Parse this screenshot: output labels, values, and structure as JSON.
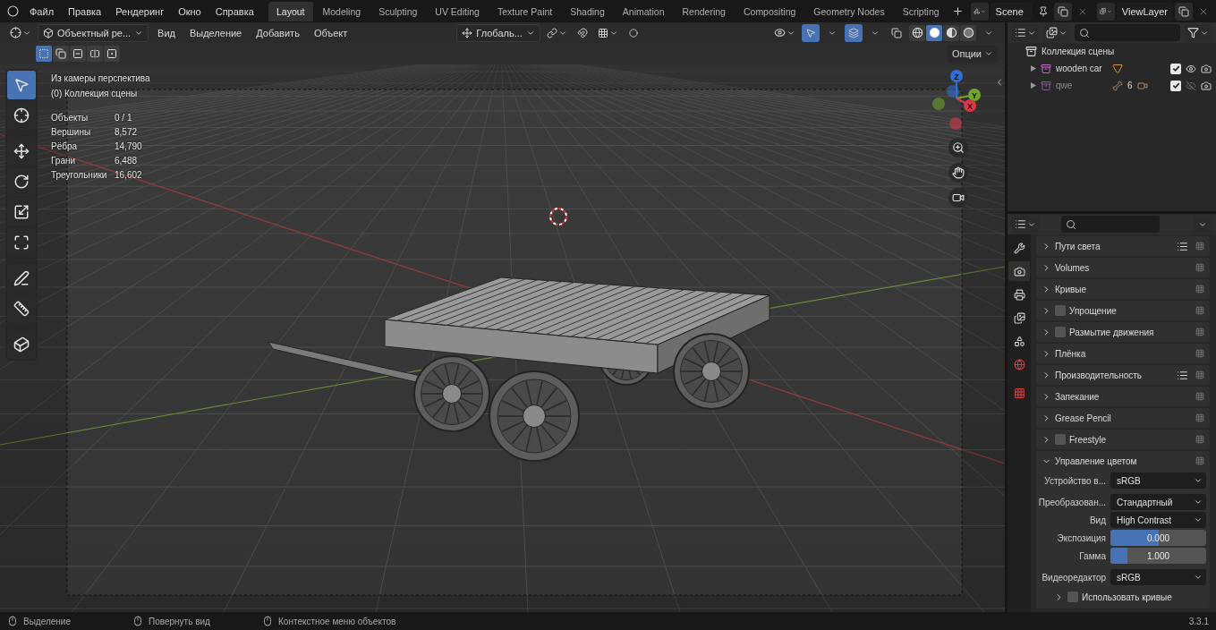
{
  "menu": [
    "Файл",
    "Правка",
    "Рендеринг",
    "Окно",
    "Справка"
  ],
  "workspaces": [
    {
      "label": "Layout",
      "selected": true
    },
    {
      "label": "Modeling",
      "selected": false
    },
    {
      "label": "Sculpting",
      "selected": false
    },
    {
      "label": "UV Editing",
      "selected": false
    },
    {
      "label": "Texture Paint",
      "selected": false
    },
    {
      "label": "Shading",
      "selected": false
    },
    {
      "label": "Animation",
      "selected": false
    },
    {
      "label": "Rendering",
      "selected": false
    },
    {
      "label": "Compositing",
      "selected": false
    },
    {
      "label": "Geometry Nodes",
      "selected": false
    },
    {
      "label": "Scripting",
      "selected": false
    }
  ],
  "scene": {
    "name": "Scene"
  },
  "view_layer": {
    "name": "ViewLayer"
  },
  "viewport_header": {
    "mode": "Объектный ре...",
    "menus": [
      "Вид",
      "Выделение",
      "Добавить",
      "Объект"
    ],
    "orientation": "Глобаль...",
    "shading": [
      {
        "kind": "wireframe",
        "selected": false
      },
      {
        "kind": "solid",
        "selected": true
      },
      {
        "kind": "material",
        "selected": false
      },
      {
        "kind": "rendered",
        "selected": false
      }
    ]
  },
  "select_modes": [
    {
      "kind": "new",
      "selected": true
    },
    {
      "kind": "extend",
      "selected": false
    },
    {
      "kind": "subtract",
      "selected": false
    },
    {
      "kind": "invert",
      "selected": false
    },
    {
      "kind": "intersect",
      "selected": false
    }
  ],
  "options_button": "Опции",
  "tools": [
    {
      "kind": "select",
      "selected": true
    },
    {
      "kind": "cursor",
      "selected": false
    },
    {
      "kind": "move",
      "selected": false
    },
    {
      "kind": "rotate",
      "selected": false
    },
    {
      "kind": "scale",
      "selected": false
    },
    {
      "kind": "transform",
      "selected": false
    },
    {
      "kind": "annotate",
      "selected": false
    },
    {
      "kind": "measure",
      "selected": false
    },
    {
      "kind": "add_cube",
      "selected": false
    }
  ],
  "overlay": {
    "view_name": "Из камеры перспектива",
    "collection": "(0) Коллекция сцены",
    "stats": [
      {
        "label": "Объекты",
        "value": "0 / 1"
      },
      {
        "label": "Вершины",
        "value": "8,572"
      },
      {
        "label": "Рёбра",
        "value": "14,790"
      },
      {
        "label": "Грани",
        "value": "6,488"
      },
      {
        "label": "Треугольники",
        "value": "16,602"
      }
    ]
  },
  "navigation_gizmo": {
    "axes": [
      {
        "label": "Z",
        "color": "#2f6fd6"
      },
      {
        "label": "Y",
        "color": "#6fa82b"
      },
      {
        "label": "X",
        "color": "#e0364a"
      }
    ]
  },
  "outliner": {
    "root": "Коллекция сцены",
    "items": [
      {
        "name": "wooden car",
        "kind": "object",
        "enabled": true,
        "visible": true
      },
      {
        "name": "qwe",
        "kind": "rig",
        "badge": "6",
        "enabled": true,
        "visible": false
      }
    ]
  },
  "properties": {
    "tabs": [
      {
        "kind": "tool",
        "selected": false
      },
      {
        "kind": "render",
        "selected": true
      },
      {
        "kind": "output",
        "selected": false
      },
      {
        "kind": "view_layer",
        "selected": false
      },
      {
        "kind": "scene",
        "selected": false
      },
      {
        "kind": "world",
        "selected": false
      },
      {
        "kind": "texture",
        "selected": false
      }
    ],
    "panels": [
      {
        "label": "Пути света",
        "kind": "plain",
        "presets": true
      },
      {
        "label": "Volumes",
        "kind": "plain",
        "presets": false
      },
      {
        "label": "Кривые",
        "kind": "plain",
        "presets": false
      },
      {
        "label": "Упрощение",
        "kind": "toggle",
        "checked": false,
        "presets": false
      },
      {
        "label": "Размытие движения",
        "kind": "toggle",
        "checked": false,
        "presets": false
      },
      {
        "label": "Плёнка",
        "kind": "plain",
        "presets": false
      },
      {
        "label": "Производительность",
        "kind": "plain",
        "presets": true
      },
      {
        "label": "Запекание",
        "kind": "plain",
        "presets": false
      },
      {
        "label": "Grease Pencil",
        "kind": "plain",
        "presets": false
      },
      {
        "label": "Freestyle",
        "kind": "toggle",
        "checked": false,
        "presets": false
      }
    ],
    "color_management": {
      "label": "Управление цветом",
      "expanded": true,
      "fields": [
        {
          "kind": "select",
          "label": "Устройство в...",
          "value": "sRGB"
        },
        {
          "kind": "select",
          "label": "Преобразован...",
          "value": "Стандартный"
        },
        {
          "kind": "select",
          "label": "Вид",
          "value": "High Contrast"
        },
        {
          "kind": "slider",
          "label": "Экспозиция",
          "value": "0.000",
          "level": 0.5
        },
        {
          "kind": "slider",
          "label": "Гамма",
          "value": "1.000",
          "level": 0.18
        },
        {
          "kind": "select",
          "label": "Видеоредактор",
          "value": "sRGB"
        }
      ],
      "subpanel": {
        "label": "Использовать кривые",
        "checked": false
      }
    }
  },
  "status_bar": {
    "hints": [
      "Выделение",
      "Повернуть вид",
      "Контекстное меню объектов"
    ],
    "version": "3.3.1"
  }
}
